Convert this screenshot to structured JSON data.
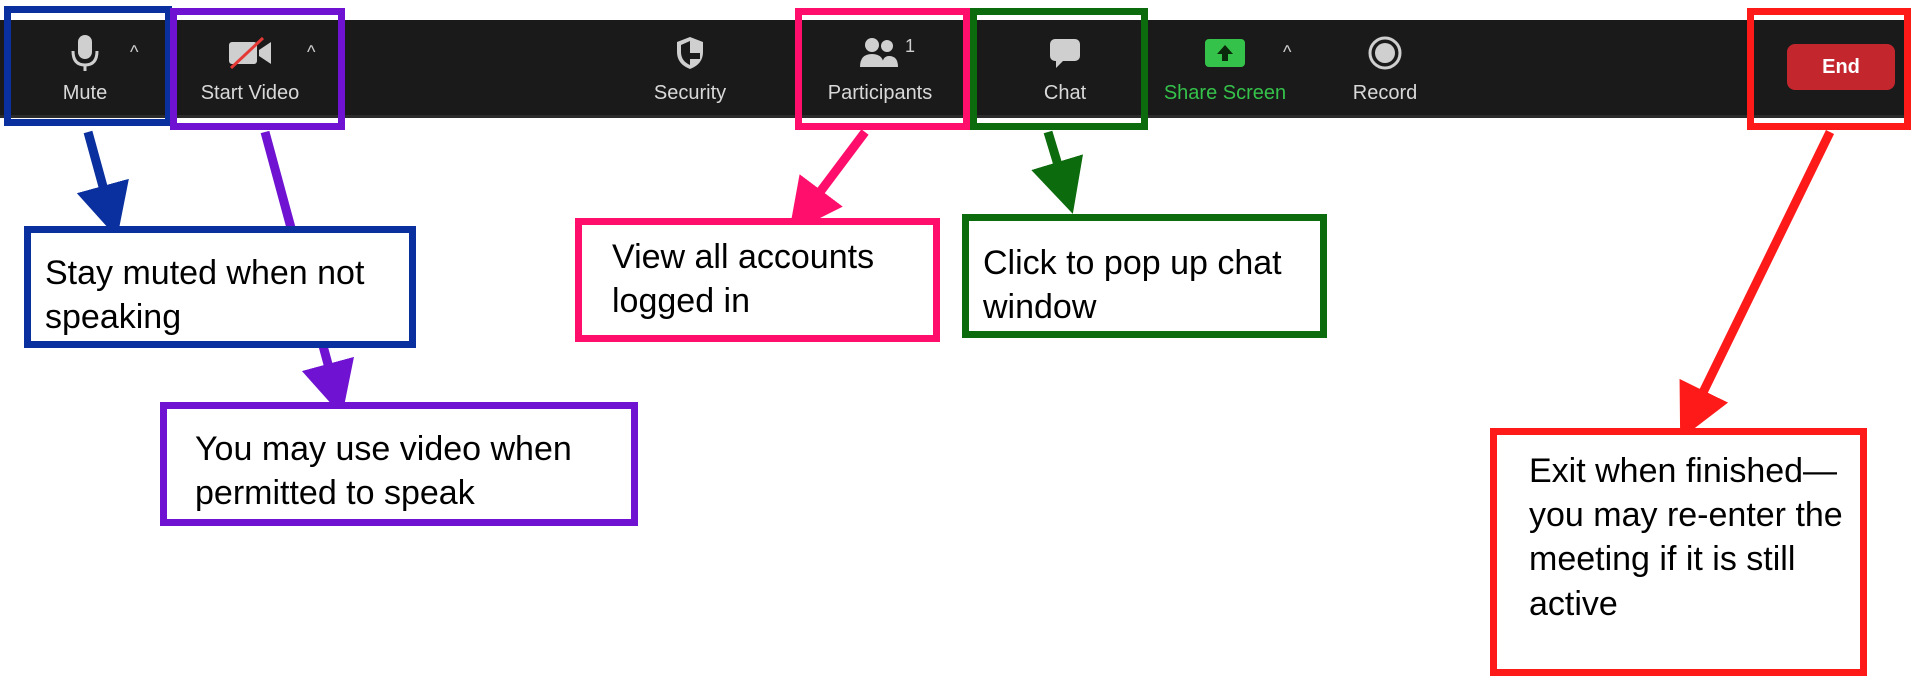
{
  "toolbar": {
    "mute_label": "Mute",
    "video_label": "Start Video",
    "security_label": "Security",
    "participants_label": "Participants",
    "participants_count": "1",
    "chat_label": "Chat",
    "share_label": "Share Screen",
    "record_label": "Record",
    "end_label": "End"
  },
  "callouts": {
    "mute_note": "Stay muted when not speaking",
    "video_note": "You may use video when permitted to speak",
    "participants_note": "View all accounts logged in",
    "chat_note": "Click to pop up chat window",
    "end_note": "Exit when finished—you may re-enter the meeting if it is still active"
  },
  "colors": {
    "mute": "#0a2f9e",
    "video": "#6f12d1",
    "participants": "#ff0f6b",
    "chat": "#0c6b0c",
    "end": "#ff1a1a",
    "share_green": "#35c24a"
  }
}
